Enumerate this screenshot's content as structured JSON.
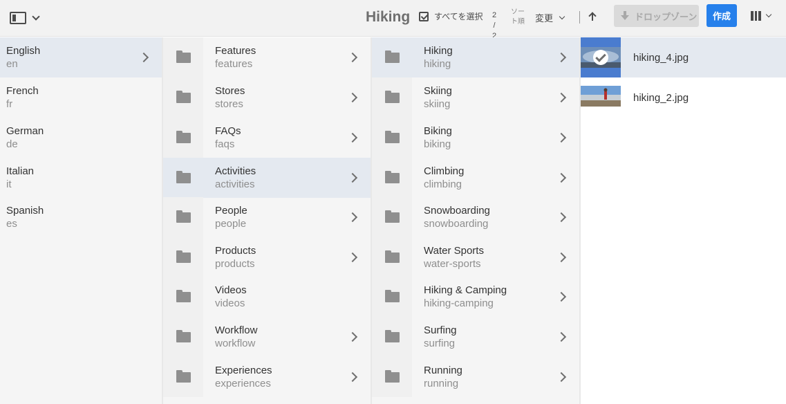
{
  "toolbar": {
    "rail_toggle_icon": "rail-icon",
    "title": "Hiking",
    "select_all_label": "すべてを選択",
    "count_top": "2 /",
    "count_bottom": "2",
    "sort_label": "ソート順",
    "sort_value": "変更",
    "sort_direction_icon": "arrow-up-icon",
    "dropzone_label": "ドロップゾーン",
    "create_label": "作成",
    "view_icon": "column-view-icon",
    "accent_color": "#2680eb"
  },
  "columns": [
    {
      "items": [
        {
          "title": "English",
          "name": "en",
          "selected": true
        },
        {
          "title": "French",
          "name": "fr"
        },
        {
          "title": "German",
          "name": "de"
        },
        {
          "title": "Italian",
          "name": "it"
        },
        {
          "title": "Spanish",
          "name": "es"
        }
      ]
    },
    {
      "items": [
        {
          "title": "Features",
          "name": "features"
        },
        {
          "title": "Stores",
          "name": "stores"
        },
        {
          "title": "FAQs",
          "name": "faqs"
        },
        {
          "title": "Activities",
          "name": "activities",
          "selected": true
        },
        {
          "title": "People",
          "name": "people"
        },
        {
          "title": "Products",
          "name": "products"
        },
        {
          "title": "Videos",
          "name": "videos"
        },
        {
          "title": "Workflow",
          "name": "workflow"
        },
        {
          "title": "Experiences",
          "name": "experiences"
        }
      ]
    },
    {
      "items": [
        {
          "title": "Hiking",
          "name": "hiking",
          "selected": true
        },
        {
          "title": "Skiing",
          "name": "skiing"
        },
        {
          "title": "Biking",
          "name": "biking"
        },
        {
          "title": "Climbing",
          "name": "climbing"
        },
        {
          "title": "Snowboarding",
          "name": "snowboarding"
        },
        {
          "title": "Water Sports",
          "name": "water-sports"
        },
        {
          "title": "Hiking & Camping",
          "name": "hiking-camping"
        },
        {
          "title": "Surfing",
          "name": "surfing"
        },
        {
          "title": "Running",
          "name": "running"
        }
      ]
    }
  ],
  "assets": [
    {
      "name": "hiking_4.jpg",
      "selected": true
    },
    {
      "name": "hiking_2.jpg",
      "selected": false
    }
  ]
}
